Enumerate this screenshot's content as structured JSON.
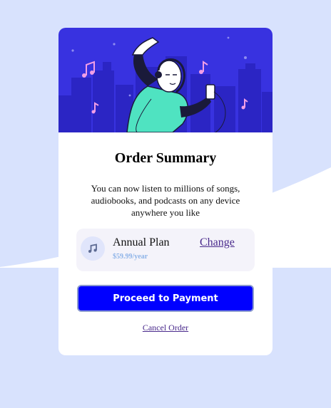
{
  "card": {
    "title": "Order Summary",
    "description": "You can now listen to millions of songs, audiobooks, and podcasts on any device anywhere you like"
  },
  "plan": {
    "name": "Annual Plan",
    "price": "$59.99/year",
    "change_label": "Change",
    "icon": "music-note-icon"
  },
  "actions": {
    "proceed_label": "Proceed to Payment",
    "cancel_label": "Cancel Order"
  },
  "colors": {
    "background": "#d8e2fd",
    "hero": "#3832e0",
    "button": "#0000ff",
    "link": "#4a2a8c",
    "price": "#8eb4e8"
  }
}
